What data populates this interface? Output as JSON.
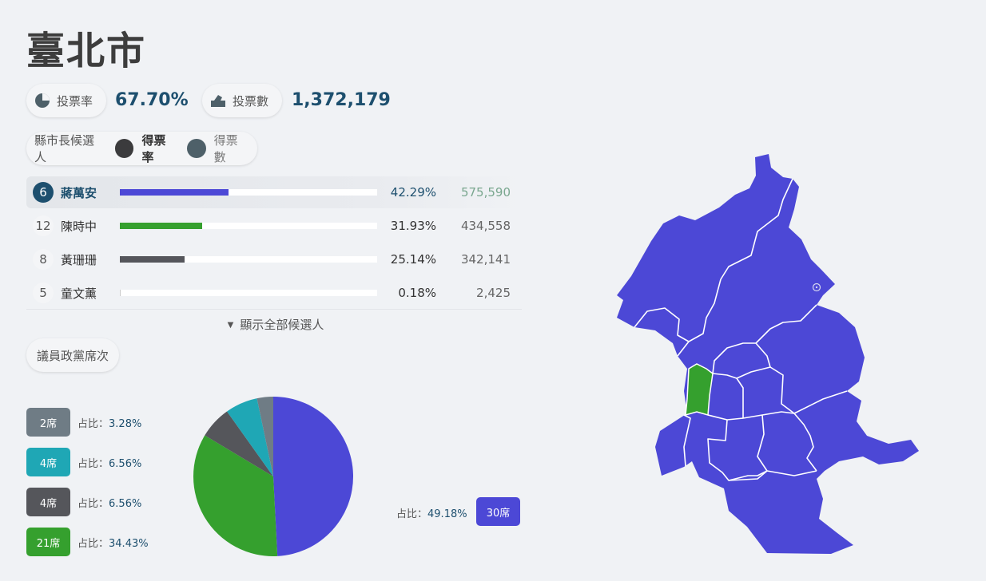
{
  "city": "臺北市",
  "turnout": {
    "label": "投票率",
    "value": "67.70%"
  },
  "total_votes": {
    "label": "投票數",
    "value": "1,372,179"
  },
  "mayor_legend": {
    "label": "縣市長候選人",
    "rate_label": "得票率",
    "count_label": "得票數"
  },
  "candidates": [
    {
      "number": "6",
      "name": "蔣萬安",
      "pct": "42.29%",
      "votes": "575,590",
      "share": 0.4229,
      "color": "#4c48d6"
    },
    {
      "number": "12",
      "name": "陳時中",
      "pct": "31.93%",
      "votes": "434,558",
      "share": 0.3193,
      "color": "#35a02e"
    },
    {
      "number": "8",
      "name": "黃珊珊",
      "pct": "25.14%",
      "votes": "342,141",
      "share": 0.2514,
      "color": "#55565b"
    },
    {
      "number": "5",
      "name": "童文薰",
      "pct": "0.18%",
      "votes": "2,425",
      "share": 0.0018,
      "color": "#cccccc"
    }
  ],
  "show_all_label": "顯示全部候選人",
  "council_label": "議員政黨席次",
  "ratio_prefix": "占比：",
  "seats": [
    {
      "seats_label": "2席",
      "ratio": "3.28%",
      "color": "#6f7c85"
    },
    {
      "seats_label": "4席",
      "ratio": "6.56%",
      "color": "#1fa7b5"
    },
    {
      "seats_label": "4席",
      "ratio": "6.56%",
      "color": "#55565b"
    },
    {
      "seats_label": "21席",
      "ratio": "34.43%",
      "color": "#35a02e"
    }
  ],
  "seat_main": {
    "seats_label": "30席",
    "ratio": "49.18%",
    "color": "#4c48d6"
  },
  "chart_data": {
    "type": "pie",
    "title": "",
    "slices": [
      {
        "label": "30席",
        "value": 49.18,
        "color": "#4c48d6"
      },
      {
        "label": "21席",
        "value": 34.43,
        "color": "#35a02e"
      },
      {
        "label": "4席",
        "value": 6.56,
        "color": "#55565b"
      },
      {
        "label": "4席",
        "value": 6.56,
        "color": "#1fa7b5"
      },
      {
        "label": "2席",
        "value": 3.28,
        "color": "#6f7c85"
      }
    ]
  },
  "map": {
    "main_color": "#4c48d6",
    "highlight_color": "#35a02e"
  },
  "icons": {
    "turnout": "pie-chart-icon",
    "votes": "ballot-box-icon",
    "show_all": "caret-down-icon"
  }
}
